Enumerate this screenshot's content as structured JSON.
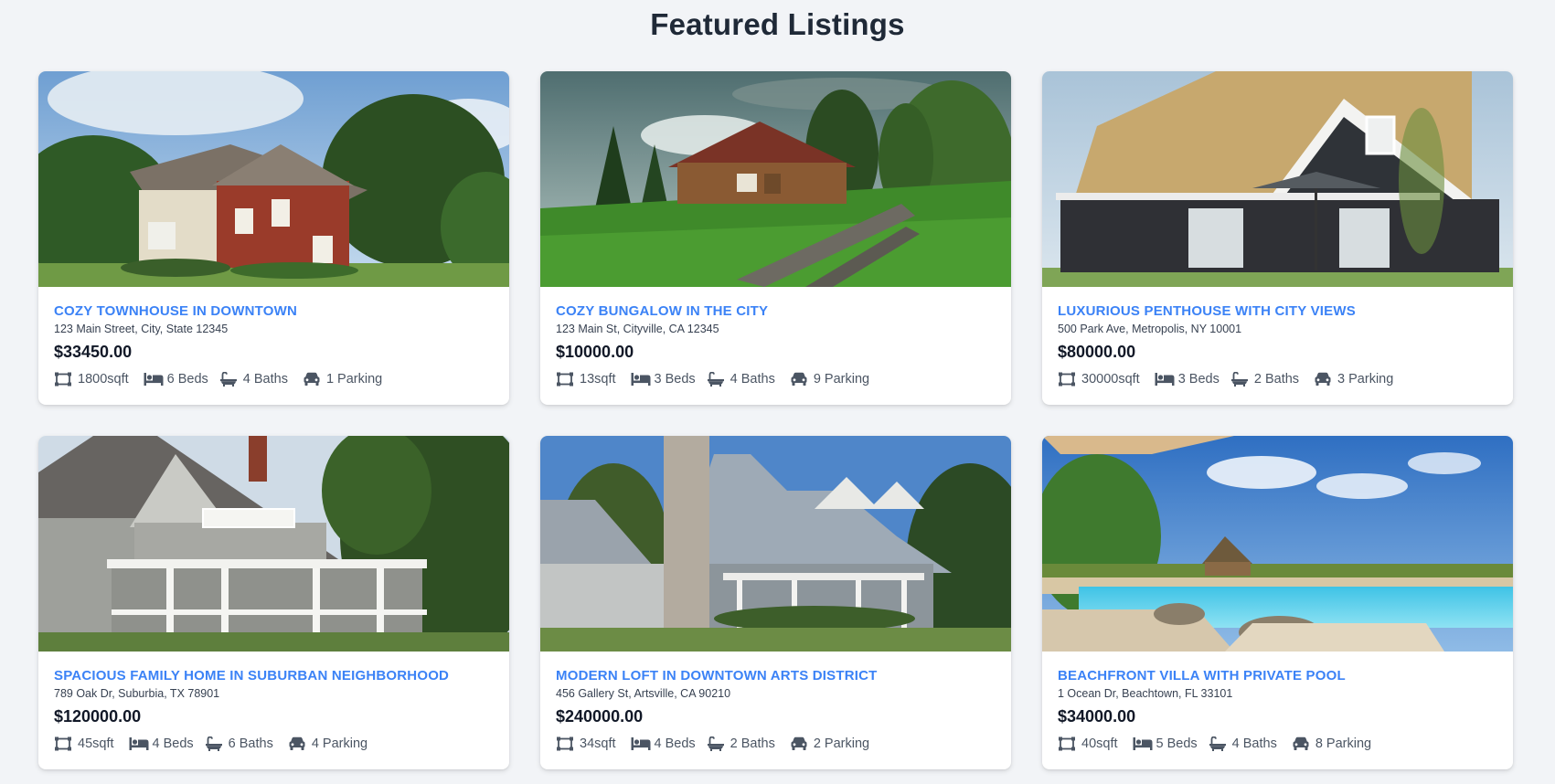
{
  "page": {
    "title": "Featured Listings"
  },
  "colors": {
    "accent": "#3b82f6",
    "background": "#f2f4f7",
    "icon": "#4b5563"
  },
  "icons": {
    "area": "area-icon",
    "beds": "bed-icon",
    "baths": "bath-icon",
    "parking": "car-icon"
  },
  "listings": [
    {
      "title": "COZY TOWNHOUSE IN DOWNTOWN",
      "address": "123 Main Street, City, State 12345",
      "price": "$33450.00",
      "area": "1800sqft",
      "beds": "6 Beds",
      "baths": "4 Baths",
      "parking": "1 Parking",
      "image": "brick-house-photo"
    },
    {
      "title": "COZY BUNGALOW IN THE CITY",
      "address": "123 Main St, Cityville, CA 12345",
      "price": "$10000.00",
      "area": "13sqft",
      "beds": "3 Beds",
      "baths": "4 Baths",
      "parking": "9 Parking",
      "image": "wooden-cabin-photo"
    },
    {
      "title": "LUXURIOUS PENTHOUSE WITH CITY VIEWS",
      "address": "500 Park Ave, Metropolis, NY 10001",
      "price": "$80000.00",
      "area": "30000sqft",
      "beds": "3 Beds",
      "baths": "2 Baths",
      "parking": "3 Parking",
      "image": "thatched-house-photo"
    },
    {
      "title": "SPACIOUS FAMILY HOME IN SUBURBAN NEIGHBORHOOD",
      "address": "789 Oak Dr, Suburbia, TX 78901",
      "price": "$120000.00",
      "area": "45sqft",
      "beds": "4 Beds",
      "baths": "6 Baths",
      "parking": "4 Parking",
      "image": "shingle-house-photo"
    },
    {
      "title": "MODERN LOFT IN DOWNTOWN ARTS DISTRICT",
      "address": "456 Gallery St, Artsville, CA 90210",
      "price": "$240000.00",
      "area": "34sqft",
      "beds": "4 Beds",
      "baths": "2 Baths",
      "parking": "2 Parking",
      "image": "stone-chimney-house-photo"
    },
    {
      "title": "BEACHFRONT VILLA WITH PRIVATE POOL",
      "address": "1 Ocean Dr, Beachtown, FL 33101",
      "price": "$34000.00",
      "area": "40sqft",
      "beds": "5 Beds",
      "baths": "4 Baths",
      "parking": "8 Parking",
      "image": "resort-pool-photo"
    }
  ]
}
